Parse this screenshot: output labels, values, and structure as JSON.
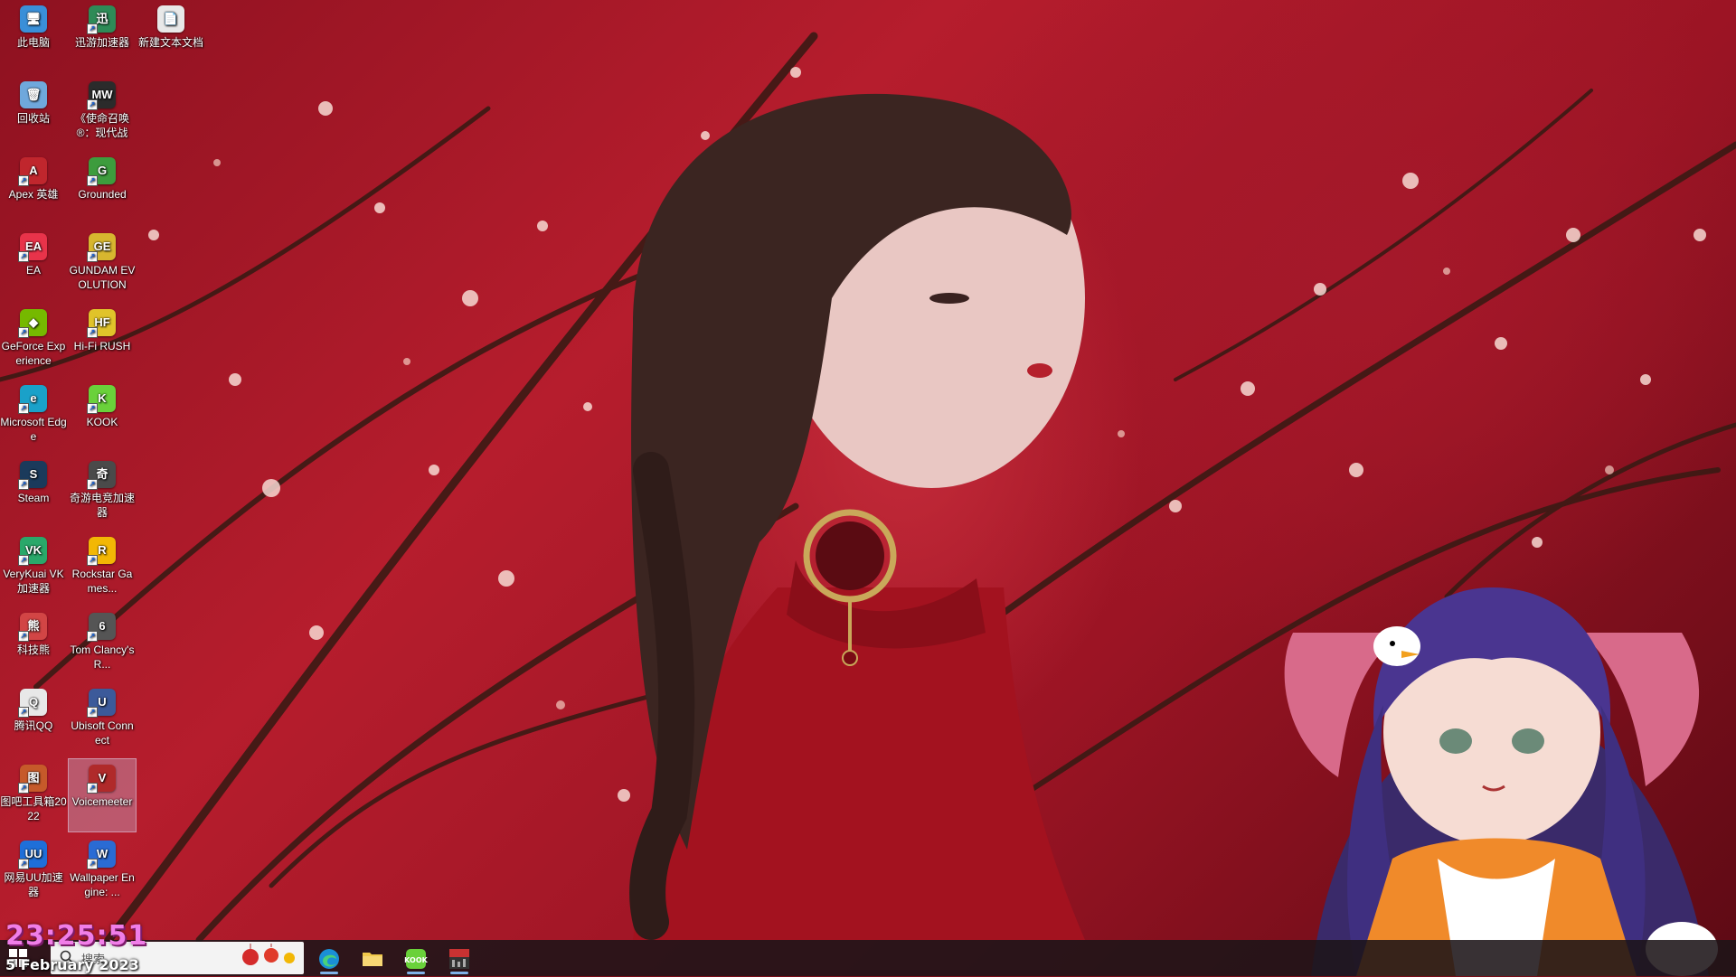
{
  "desktop": {
    "icons": [
      {
        "label": "此电脑",
        "icon": "computer-icon",
        "color": "#3a8fd8",
        "glyph": "🖥"
      },
      {
        "label": "迅游加速器",
        "icon": "xunyou-icon",
        "color": "#2e8b57",
        "glyph": "迅"
      },
      {
        "label": "新建文本文档",
        "icon": "text-document-icon",
        "color": "#e8e8e8",
        "glyph": "📄"
      },
      {
        "label": "回收站",
        "icon": "recycle-bin-icon",
        "color": "#6fa8dc",
        "glyph": "🗑"
      },
      {
        "label": "《使命召唤®：现代战争...",
        "icon": "mw2-icon",
        "color": "#2b2b2b",
        "glyph": "MW"
      },
      {
        "label": "Apex 英雄",
        "icon": "apex-icon",
        "color": "#c0262d",
        "glyph": "A"
      },
      {
        "label": "Grounded",
        "icon": "grounded-icon",
        "color": "#3d9c3d",
        "glyph": "G"
      },
      {
        "label": "EA",
        "icon": "ea-icon",
        "color": "#e8334a",
        "glyph": "EA"
      },
      {
        "label": "GUNDAM EVOLUTION",
        "icon": "gundam-icon",
        "color": "#d7b62f",
        "glyph": "GE"
      },
      {
        "label": "GeForce Experience",
        "icon": "geforce-icon",
        "color": "#76b900",
        "glyph": "◆"
      },
      {
        "label": "Hi-Fi RUSH",
        "icon": "hifi-rush-icon",
        "color": "#e0c32a",
        "glyph": "HF"
      },
      {
        "label": "Microsoft Edge",
        "icon": "edge-icon",
        "color": "#1aa1c9",
        "glyph": "e"
      },
      {
        "label": "KOOK",
        "icon": "kook-icon",
        "color": "#6ad13a",
        "glyph": "K"
      },
      {
        "label": "Steam",
        "icon": "steam-icon",
        "color": "#1b3a5b",
        "glyph": "S"
      },
      {
        "label": "奇游电竞加速器",
        "icon": "qiyou-icon",
        "color": "#4a4a4a",
        "glyph": "奇"
      },
      {
        "label": "VeryKuai VK加速器",
        "icon": "verykuai-icon",
        "color": "#2aa86a",
        "glyph": "VK"
      },
      {
        "label": "Rockstar Games...",
        "icon": "rockstar-icon",
        "color": "#f2b705",
        "glyph": "R"
      },
      {
        "label": "科技熊",
        "icon": "kejixiong-icon",
        "color": "#d24545",
        "glyph": "熊"
      },
      {
        "label": "Tom Clancy's R...",
        "icon": "rainbow-six-icon",
        "color": "#555555",
        "glyph": "6"
      },
      {
        "label": "腾讯QQ",
        "icon": "qq-icon",
        "color": "#e8e8e8",
        "glyph": "Q"
      },
      {
        "label": "Ubisoft Connect",
        "icon": "ubisoft-icon",
        "color": "#3c5a9a",
        "glyph": "U"
      },
      {
        "label": "图吧工具箱2022",
        "icon": "tuba-toolbox-icon",
        "color": "#c65a2a",
        "glyph": "图"
      },
      {
        "label": "Voicemeeter",
        "icon": "voicemeeter-icon",
        "color": "#b02a2a",
        "glyph": "V"
      },
      {
        "label": "网易UU加速器",
        "icon": "uu-icon",
        "color": "#1e6fd9",
        "glyph": "UU"
      },
      {
        "label": "Wallpaper Engine: ...",
        "icon": "wallpaper-engine-icon",
        "color": "#2a6bd4",
        "glyph": "W"
      }
    ]
  },
  "taskbar": {
    "search_placeholder": "搜索",
    "apps": [
      {
        "name": "edge",
        "icon": "edge-icon"
      },
      {
        "name": "file-explorer",
        "icon": "folder-icon"
      },
      {
        "name": "kook",
        "icon": "kook-icon"
      },
      {
        "name": "voicemeeter",
        "icon": "voicemeeter-icon"
      }
    ]
  },
  "overlay": {
    "clock": "23:25:51",
    "date": "5 February 2023"
  }
}
